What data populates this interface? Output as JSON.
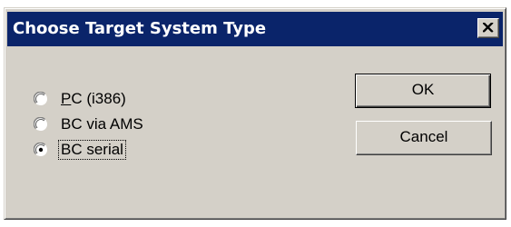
{
  "dialog": {
    "title": "Choose Target System Type",
    "close_label": "×"
  },
  "options": [
    {
      "mnemonic": "P",
      "rest": "C (i386)",
      "selected": false
    },
    {
      "mnemonic": "",
      "rest": "BC via AMS",
      "selected": false
    },
    {
      "mnemonic": "",
      "rest": "BC serial",
      "selected": true
    }
  ],
  "buttons": {
    "ok_label": "OK",
    "cancel_label": "Cancel"
  },
  "colors": {
    "titlebar": "#0a246a",
    "face": "#d4d0c8"
  }
}
